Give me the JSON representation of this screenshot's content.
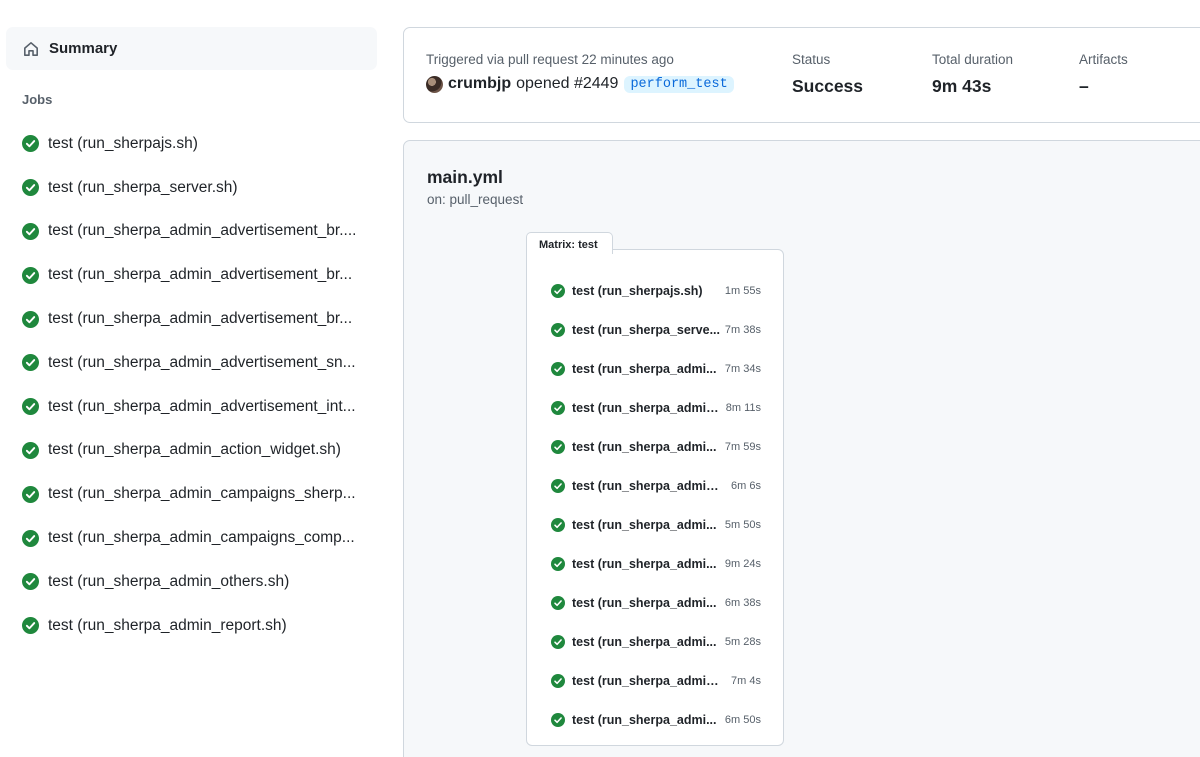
{
  "sidebar": {
    "summary_label": "Summary",
    "jobs_heading": "Jobs",
    "jobs": [
      {
        "name": "test (run_sherpajs.sh)"
      },
      {
        "name": "test (run_sherpa_server.sh)"
      },
      {
        "name": "test (run_sherpa_admin_advertisement_br...."
      },
      {
        "name": "test (run_sherpa_admin_advertisement_br..."
      },
      {
        "name": "test (run_sherpa_admin_advertisement_br..."
      },
      {
        "name": "test (run_sherpa_admin_advertisement_sn..."
      },
      {
        "name": "test (run_sherpa_admin_advertisement_int..."
      },
      {
        "name": "test (run_sherpa_admin_action_widget.sh)"
      },
      {
        "name": "test (run_sherpa_admin_campaigns_sherp..."
      },
      {
        "name": "test (run_sherpa_admin_campaigns_comp..."
      },
      {
        "name": "test (run_sherpa_admin_others.sh)"
      },
      {
        "name": "test (run_sherpa_admin_report.sh)"
      }
    ]
  },
  "run": {
    "trigger_label": "Triggered via pull request 22 minutes ago",
    "user": "crumbjp",
    "action": "opened #2449",
    "branch": "perform_test",
    "status_label": "Status",
    "status_value": "Success",
    "duration_label": "Total duration",
    "duration_value": "9m 43s",
    "artifacts_label": "Artifacts",
    "artifacts_value": "–"
  },
  "workflow": {
    "file": "main.yml",
    "trigger": "on: pull_request",
    "matrix_label": "Matrix: test",
    "jobs": [
      {
        "name": "test (run_sherpajs.sh)",
        "time": "1m 55s"
      },
      {
        "name": "test (run_sherpa_serve...",
        "time": "7m 38s"
      },
      {
        "name": "test (run_sherpa_admi...",
        "time": "7m 34s"
      },
      {
        "name": "test (run_sherpa_admin...",
        "time": "8m 11s"
      },
      {
        "name": "test (run_sherpa_admi...",
        "time": "7m 59s"
      },
      {
        "name": "test (run_sherpa_admin...",
        "time": "6m 6s"
      },
      {
        "name": "test (run_sherpa_admi...",
        "time": "5m 50s"
      },
      {
        "name": "test (run_sherpa_admi...",
        "time": "9m 24s"
      },
      {
        "name": "test (run_sherpa_admi...",
        "time": "6m 38s"
      },
      {
        "name": "test (run_sherpa_admi...",
        "time": "5m 28s"
      },
      {
        "name": "test (run_sherpa_admin...",
        "time": "7m 4s"
      },
      {
        "name": "test (run_sherpa_admi...",
        "time": "6m 50s"
      }
    ]
  },
  "colors": {
    "success": "#1f883d",
    "link": "#0969da",
    "muted": "#57606a",
    "border": "#d0d7de"
  },
  "icons": {
    "summary": "home-icon",
    "job_status": "check-circle-icon"
  }
}
